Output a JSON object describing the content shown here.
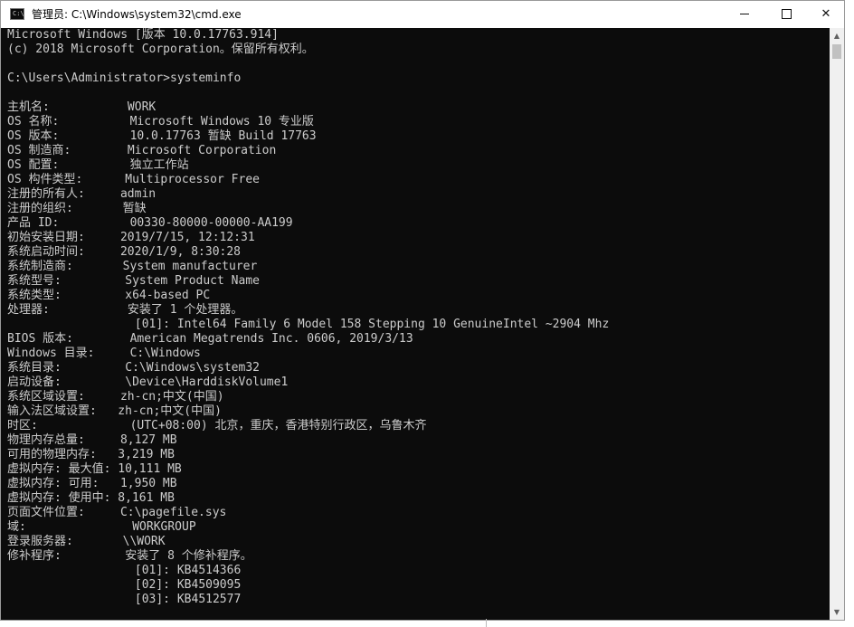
{
  "window": {
    "title": "管理员: C:\\Windows\\system32\\cmd.exe",
    "icon": "cmd-icon",
    "controls": {
      "minimize": "minimize-icon",
      "maximize": "maximize-icon",
      "close": "✕"
    }
  },
  "console": {
    "lines": [
      "Microsoft Windows [版本 10.0.17763.914]",
      "(c) 2018 Microsoft Corporation。保留所有权利。",
      "",
      "C:\\Users\\Administrator>systeminfo",
      "",
      "主机名:           WORK",
      "OS 名称:          Microsoft Windows 10 专业版",
      "OS 版本:          10.0.17763 暂缺 Build 17763",
      "OS 制造商:        Microsoft Corporation",
      "OS 配置:          独立工作站",
      "OS 构件类型:      Multiprocessor Free",
      "注册的所有人:     admin",
      "注册的组织:       暂缺",
      "产品 ID:          00330-80000-00000-AA199",
      "初始安装日期:     2019/7/15, 12:12:31",
      "系统启动时间:     2020/1/9, 8:30:28",
      "系统制造商:       System manufacturer",
      "系统型号:         System Product Name",
      "系统类型:         x64-based PC",
      "处理器:           安装了 1 个处理器。",
      "                  [01]: Intel64 Family 6 Model 158 Stepping 10 GenuineIntel ~2904 Mhz",
      "BIOS 版本:        American Megatrends Inc. 0606, 2019/3/13",
      "Windows 目录:     C:\\Windows",
      "系统目录:         C:\\Windows\\system32",
      "启动设备:         \\Device\\HarddiskVolume1",
      "系统区域设置:     zh-cn;中文(中国)",
      "输入法区域设置:   zh-cn;中文(中国)",
      "时区:             (UTC+08:00) 北京，重庆，香港特别行政区，乌鲁木齐",
      "物理内存总量:     8,127 MB",
      "可用的物理内存:   3,219 MB",
      "虚拟内存: 最大值: 10,111 MB",
      "虚拟内存: 可用:   1,950 MB",
      "虚拟内存: 使用中: 8,161 MB",
      "页面文件位置:     C:\\pagefile.sys",
      "域:               WORKGROUP",
      "登录服务器:       \\\\WORK",
      "修补程序:         安装了 8 个修补程序。",
      "                  [01]: KB4514366",
      "                  [02]: KB4509095",
      "                  [03]: KB4512577"
    ]
  },
  "scrollbar": {
    "up": "▲",
    "down": "▼"
  }
}
